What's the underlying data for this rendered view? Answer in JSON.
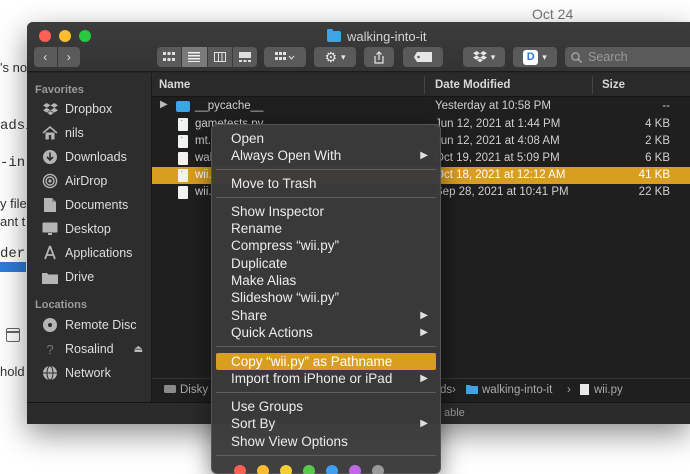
{
  "background": {
    "date": "Oct 24",
    "frag1": "'s no",
    "frag2": "ads/",
    "frag3": "-in",
    "frag4a": "y file",
    "frag4b": "ant t",
    "frag5": "der-",
    "frag6": "hold"
  },
  "window": {
    "title": "walking-into-it",
    "search_placeholder": "Search"
  },
  "sidebar": {
    "favorites_heading": "Favorites",
    "favorites": [
      {
        "label": "Dropbox",
        "icon": "dropbox-icon"
      },
      {
        "label": "nils",
        "icon": "home-icon"
      },
      {
        "label": "Downloads",
        "icon": "downloads-icon"
      },
      {
        "label": "AirDrop",
        "icon": "airdrop-icon"
      },
      {
        "label": "Documents",
        "icon": "documents-icon"
      },
      {
        "label": "Desktop",
        "icon": "desktop-icon"
      },
      {
        "label": "Applications",
        "icon": "applications-icon"
      },
      {
        "label": "Drive",
        "icon": "folder-icon"
      }
    ],
    "locations_heading": "Locations",
    "locations": [
      {
        "label": "Remote Disc",
        "icon": "disc-icon"
      },
      {
        "label": "Rosalind",
        "icon": "computer-icon"
      },
      {
        "label": "Network",
        "icon": "network-icon"
      }
    ]
  },
  "list": {
    "col_name": "Name",
    "col_date": "Date Modified",
    "col_size": "Size",
    "rows": [
      {
        "name": "__pycache__",
        "date": "Yesterday at 10:58 PM",
        "size": "--"
      },
      {
        "name": "gametests.py",
        "date": "Jun 12, 2021 at 1:44 PM",
        "size": "4 KB"
      },
      {
        "name": "mt.",
        "date": "Jun 12, 2021 at 4:08 AM",
        "size": "2 KB"
      },
      {
        "name": "wal",
        "date": "Oct 19, 2021 at 5:09 PM",
        "size": "6 KB"
      },
      {
        "name": "wii.",
        "date": "Oct 18, 2021 at 12:12 AM",
        "size": "41 KB"
      },
      {
        "name": "wii.",
        "date": "Sep 28, 2021 at 10:41 PM",
        "size": "22 KB"
      }
    ]
  },
  "pathbar": {
    "root": "Disky",
    "mid": "ds",
    "folder": "walking-into-it",
    "file": "wii.py"
  },
  "statusbar": {
    "text": "able"
  },
  "menu": {
    "open": "Open",
    "always_open_with": "Always Open With",
    "move_to_trash": "Move to Trash",
    "show_inspector": "Show Inspector",
    "rename": "Rename",
    "compress": "Compress “wii.py”",
    "duplicate": "Duplicate",
    "make_alias": "Make Alias",
    "slideshow": "Slideshow “wii.py”",
    "share": "Share",
    "quick_actions": "Quick Actions",
    "copy_pathname": "Copy “wii.py” as Pathname",
    "import_iphone": "Import from iPhone or iPad",
    "use_groups": "Use Groups",
    "sort_by": "Sort By",
    "show_view_options": "Show View Options",
    "tag_colors": [
      "#ff5f57",
      "#febc2e",
      "#f2d031",
      "#5ac84b",
      "#3ea0f5",
      "#c067e8",
      "#9a9a9a"
    ]
  }
}
